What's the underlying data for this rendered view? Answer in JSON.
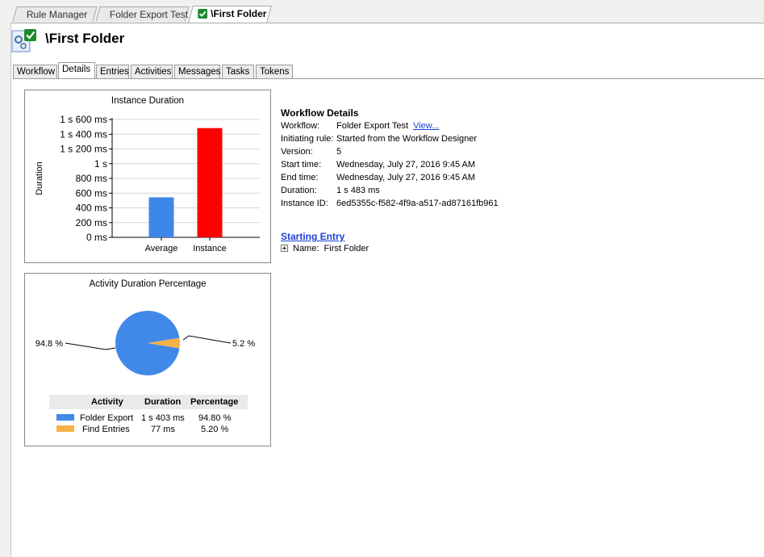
{
  "tabs": [
    {
      "label": "Rule Manager",
      "active": false
    },
    {
      "label": "Folder Export Test",
      "active": false
    },
    {
      "label": "\\First Folder",
      "active": true
    }
  ],
  "title": "\\First Folder",
  "subtabs": [
    "Workflow",
    "Details",
    "Entries",
    "Activities",
    "Messages",
    "Tasks",
    "Tokens"
  ],
  "active_subtab": "Details",
  "colors": {
    "average": "#3f86ea",
    "instance": "#ff0000",
    "folder_export": "#4189e8",
    "find_entries": "#f6b147"
  },
  "chart_data": [
    {
      "type": "bar",
      "title": "Instance Duration",
      "ylabel": "Duration",
      "categories": [
        "Average",
        "Instance"
      ],
      "values": [
        543,
        1483
      ],
      "ylim": [
        0,
        1600
      ],
      "yticks": [
        {
          "value": 0,
          "label": "0 ms"
        },
        {
          "value": 200,
          "label": "200 ms"
        },
        {
          "value": 400,
          "label": "400 ms"
        },
        {
          "value": 600,
          "label": "600 ms"
        },
        {
          "value": 800,
          "label": "800 ms"
        },
        {
          "value": 1000,
          "label": "1 s"
        },
        {
          "value": 1200,
          "label": "1 s 200 ms"
        },
        {
          "value": 1400,
          "label": "1 s 400 ms"
        },
        {
          "value": 1600,
          "label": "1 s 600 ms"
        }
      ],
      "grid": true
    },
    {
      "type": "pie",
      "title": "Activity Duration Percentage",
      "categories": [
        "Folder Export",
        "Find Entries"
      ],
      "values": [
        94.8,
        5.2
      ],
      "labels": [
        "94.8 %",
        "5.2 %"
      ]
    }
  ],
  "activity_table": {
    "headers": [
      "Activity",
      "Duration",
      "Percentage"
    ],
    "rows": [
      {
        "activity": "Folder Export",
        "duration": "1 s 403 ms",
        "percentage": "94.80 %"
      },
      {
        "activity": "Find Entries",
        "duration": "77 ms",
        "percentage": "5.20 %"
      }
    ]
  },
  "workflow_details": {
    "heading": "Workflow Details",
    "rows": [
      {
        "key": "Workflow:",
        "value": "Folder Export Test"
      },
      {
        "key": "Initiating rule:",
        "value": "Started from the Workflow Designer"
      },
      {
        "key": "Version:",
        "value": "5"
      },
      {
        "key": "Start time:",
        "value": "Wednesday, July 27, 2016 9:45 AM"
      },
      {
        "key": "End time:",
        "value": "Wednesday, July 27, 2016 9:45 AM"
      },
      {
        "key": "Duration:",
        "value": "1 s 483 ms"
      },
      {
        "key": "Instance ID:",
        "value": "6ed5355c-f582-4f9a-a517-ad87161fb961"
      }
    ],
    "view_link": "View..."
  },
  "starting_entry": {
    "label": "Starting Entry",
    "name_key": "Name:",
    "name_value": "First Folder"
  }
}
